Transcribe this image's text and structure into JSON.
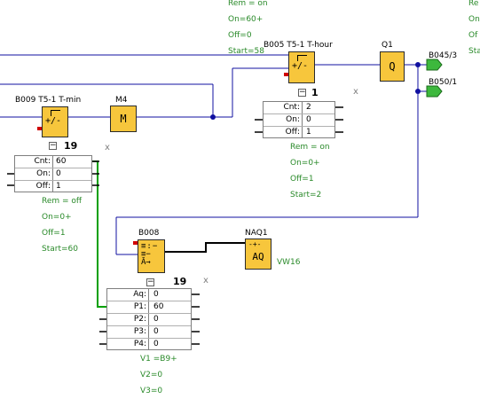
{
  "top_ann": {
    "rem": "Rem = on",
    "on": "On=60+",
    "off": "Off=0",
    "start": "Start=58"
  },
  "right_ann": [
    "Re",
    "On",
    "Of",
    "Sta"
  ],
  "b009": {
    "label": "B009 T5-1 T-min",
    "count": "19",
    "params": [
      [
        "Cnt:",
        "60"
      ],
      [
        "On:",
        "0"
      ],
      [
        "Off:",
        "1"
      ]
    ],
    "ann": [
      "Rem = off",
      "On=0+",
      "Off=1",
      "Start=60"
    ]
  },
  "m4": {
    "label": "M4",
    "glyph": "M"
  },
  "b005": {
    "label": "B005 T5-1 T-hour",
    "count": "1",
    "params": [
      [
        "Cnt:",
        "2"
      ],
      [
        "On:",
        "0"
      ],
      [
        "Off:",
        "1"
      ]
    ],
    "ann": [
      "Rem = on",
      "On=0+",
      "Off=1",
      "Start=2"
    ]
  },
  "q1": {
    "label": "Q1",
    "glyph": "Q"
  },
  "outputs": {
    "b045": "B045/3",
    "b050": "B050/1"
  },
  "b008": {
    "label": "B008",
    "count": "19",
    "params": [
      [
        "Aq:",
        "0"
      ],
      [
        "P1:",
        "60"
      ],
      [
        "P2:",
        "0"
      ],
      [
        "P3:",
        "0"
      ],
      [
        "P4:",
        "0"
      ]
    ],
    "ann": [
      "V1  =B9+",
      "V2=0",
      "V3=0"
    ]
  },
  "naq1": {
    "label": "NAQ1",
    "glyph": "AQ",
    "var": "VW16"
  },
  "x_mark": "x",
  "minus_sign": "−",
  "counter_glyph": "+/-",
  "colors": {
    "wire": "#1010a0",
    "block": "#f7c63c",
    "annotation": "#2a8a2a",
    "green_wire": "#00a000",
    "output_arrow": "#3db83d"
  }
}
